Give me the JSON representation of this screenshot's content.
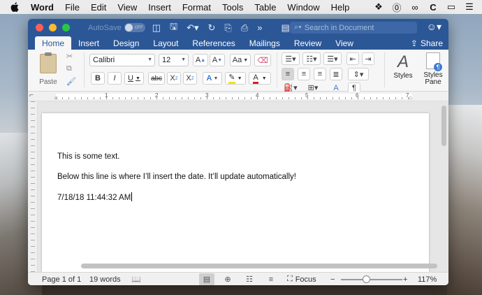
{
  "menubar": {
    "app_name": "Word",
    "items": [
      "File",
      "Edit",
      "View",
      "Insert",
      "Format",
      "Tools",
      "Table",
      "Window",
      "Help"
    ],
    "tray": [
      "dropbox-icon",
      "onepassword-icon",
      "creative-cloud-icon",
      "c-icon",
      "airplay-icon",
      "notification-icon"
    ]
  },
  "titlebar": {
    "autosave_label": "AutoSave",
    "autosave_state": "OFF",
    "search_placeholder": "Search in Document"
  },
  "tabs": [
    "Home",
    "Insert",
    "Design",
    "Layout",
    "References",
    "Mailings",
    "Review",
    "View"
  ],
  "active_tab": "Home",
  "share_label": "Share",
  "ribbon": {
    "paste_label": "Paste",
    "font_name": "Calibri",
    "font_size": "12",
    "styles_label": "Styles",
    "styles_pane_label": "Styles Pane",
    "style_bold": "B",
    "style_italic": "I",
    "style_underline": "U",
    "style_strike": "abc",
    "subscript_base": "X",
    "subscript_mark": "2",
    "superscript_base": "X",
    "superscript_mark": "2",
    "grow_font": "A",
    "shrink_font": "A",
    "change_case": "Aa",
    "text_effects": "A",
    "font_color": "A",
    "sort": "A",
    "pilcrow": "¶",
    "styles_glyph": "A",
    "colors": {
      "highlight": "#f7e11b",
      "font_color": "#d9201c"
    }
  },
  "ruler": {
    "numbers": [
      "1",
      "2",
      "3",
      "4",
      "5",
      "6",
      "7"
    ]
  },
  "document": {
    "line1": "This is some text.",
    "line2": "Below this line is where I’ll insert the date. It’ll update automatically!",
    "line3": "7/18/18 11:44:32 AM"
  },
  "statusbar": {
    "page": "Page 1 of 1",
    "words": "19 words",
    "focus_label": "Focus",
    "zoom_minus": "−",
    "zoom_plus": "+",
    "zoom": "117%",
    "zoom_fraction": 0.42
  }
}
